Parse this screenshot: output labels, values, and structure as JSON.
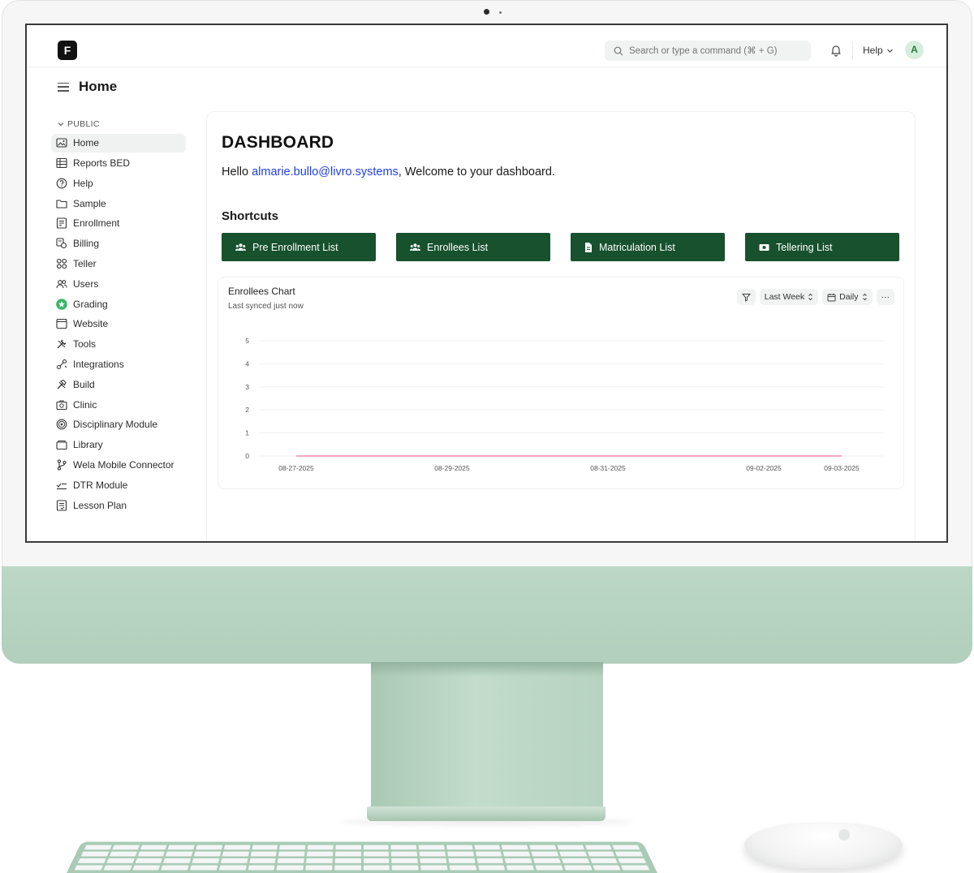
{
  "navbar": {
    "logo_letter": "F",
    "search_placeholder": "Search or type a command (⌘ + G)",
    "help_label": "Help",
    "avatar_initial": "A"
  },
  "page": {
    "title": "Home"
  },
  "sidebar": {
    "section_label": "PUBLIC",
    "items": [
      {
        "label": "Home",
        "icon": "image-icon"
      },
      {
        "label": "Reports BED",
        "icon": "table-icon"
      },
      {
        "label": "Help",
        "icon": "help-circle-icon"
      },
      {
        "label": "Sample",
        "icon": "folder-icon"
      },
      {
        "label": "Enrollment",
        "icon": "form-icon"
      },
      {
        "label": "Billing",
        "icon": "billing-icon"
      },
      {
        "label": "Teller",
        "icon": "grid-icon"
      },
      {
        "label": "Users",
        "icon": "users-icon"
      },
      {
        "label": "Grading",
        "icon": "star-badge-icon"
      },
      {
        "label": "Website",
        "icon": "browser-icon"
      },
      {
        "label": "Tools",
        "icon": "tools-icon"
      },
      {
        "label": "Integrations",
        "icon": "integrations-icon"
      },
      {
        "label": "Build",
        "icon": "build-icon"
      },
      {
        "label": "Clinic",
        "icon": "clinic-icon"
      },
      {
        "label": "Disciplinary Module",
        "icon": "target-icon"
      },
      {
        "label": "Library",
        "icon": "library-icon"
      },
      {
        "label": "Wela Mobile Connector",
        "icon": "branch-icon"
      },
      {
        "label": "DTR Module",
        "icon": "checklist-icon"
      },
      {
        "label": "Lesson Plan",
        "icon": "notes-icon"
      }
    ]
  },
  "dashboard": {
    "title": "DASHBOARD",
    "greeting_prefix": "Hello ",
    "email": "almarie.bullo@livro.systems",
    "greeting_suffix": ", Welcome to your dashboard.",
    "shortcuts_title": "Shortcuts",
    "shortcuts": [
      {
        "label": "Pre Enrollment List",
        "icon": "users-icon"
      },
      {
        "label": "Enrollees List",
        "icon": "users-icon"
      },
      {
        "label": "Matriculation List",
        "icon": "document-icon"
      },
      {
        "label": "Tellering List",
        "icon": "money-icon"
      }
    ]
  },
  "chart_card": {
    "title": "Enrollees Chart",
    "subtitle": "Last synced just now",
    "range_label": "Last Week",
    "interval_label": "Daily",
    "more_label": "···"
  },
  "colors": {
    "accent": "#17512d",
    "link": "#1f3fe0",
    "series_line": "#f08cb0",
    "monitor_green": "#b6d2c0"
  },
  "chart_data": {
    "type": "line",
    "title": "Enrollees Chart",
    "x": [
      "08-27-2025",
      "08-28-2025",
      "08-29-2025",
      "08-30-2025",
      "08-31-2025",
      "09-01-2025",
      "09-02-2025",
      "09-03-2025"
    ],
    "x_tick_labels": [
      "08-27-2025",
      "08-29-2025",
      "08-31-2025",
      "09-02-2025",
      "09-03-2025"
    ],
    "series": [
      {
        "values": [
          0,
          0,
          0,
          0,
          0,
          0,
          0,
          0
        ]
      }
    ],
    "y_ticks": [
      0,
      1,
      2,
      3,
      4,
      5
    ],
    "ylim": [
      0,
      5
    ],
    "grid": true,
    "legend": "none"
  }
}
